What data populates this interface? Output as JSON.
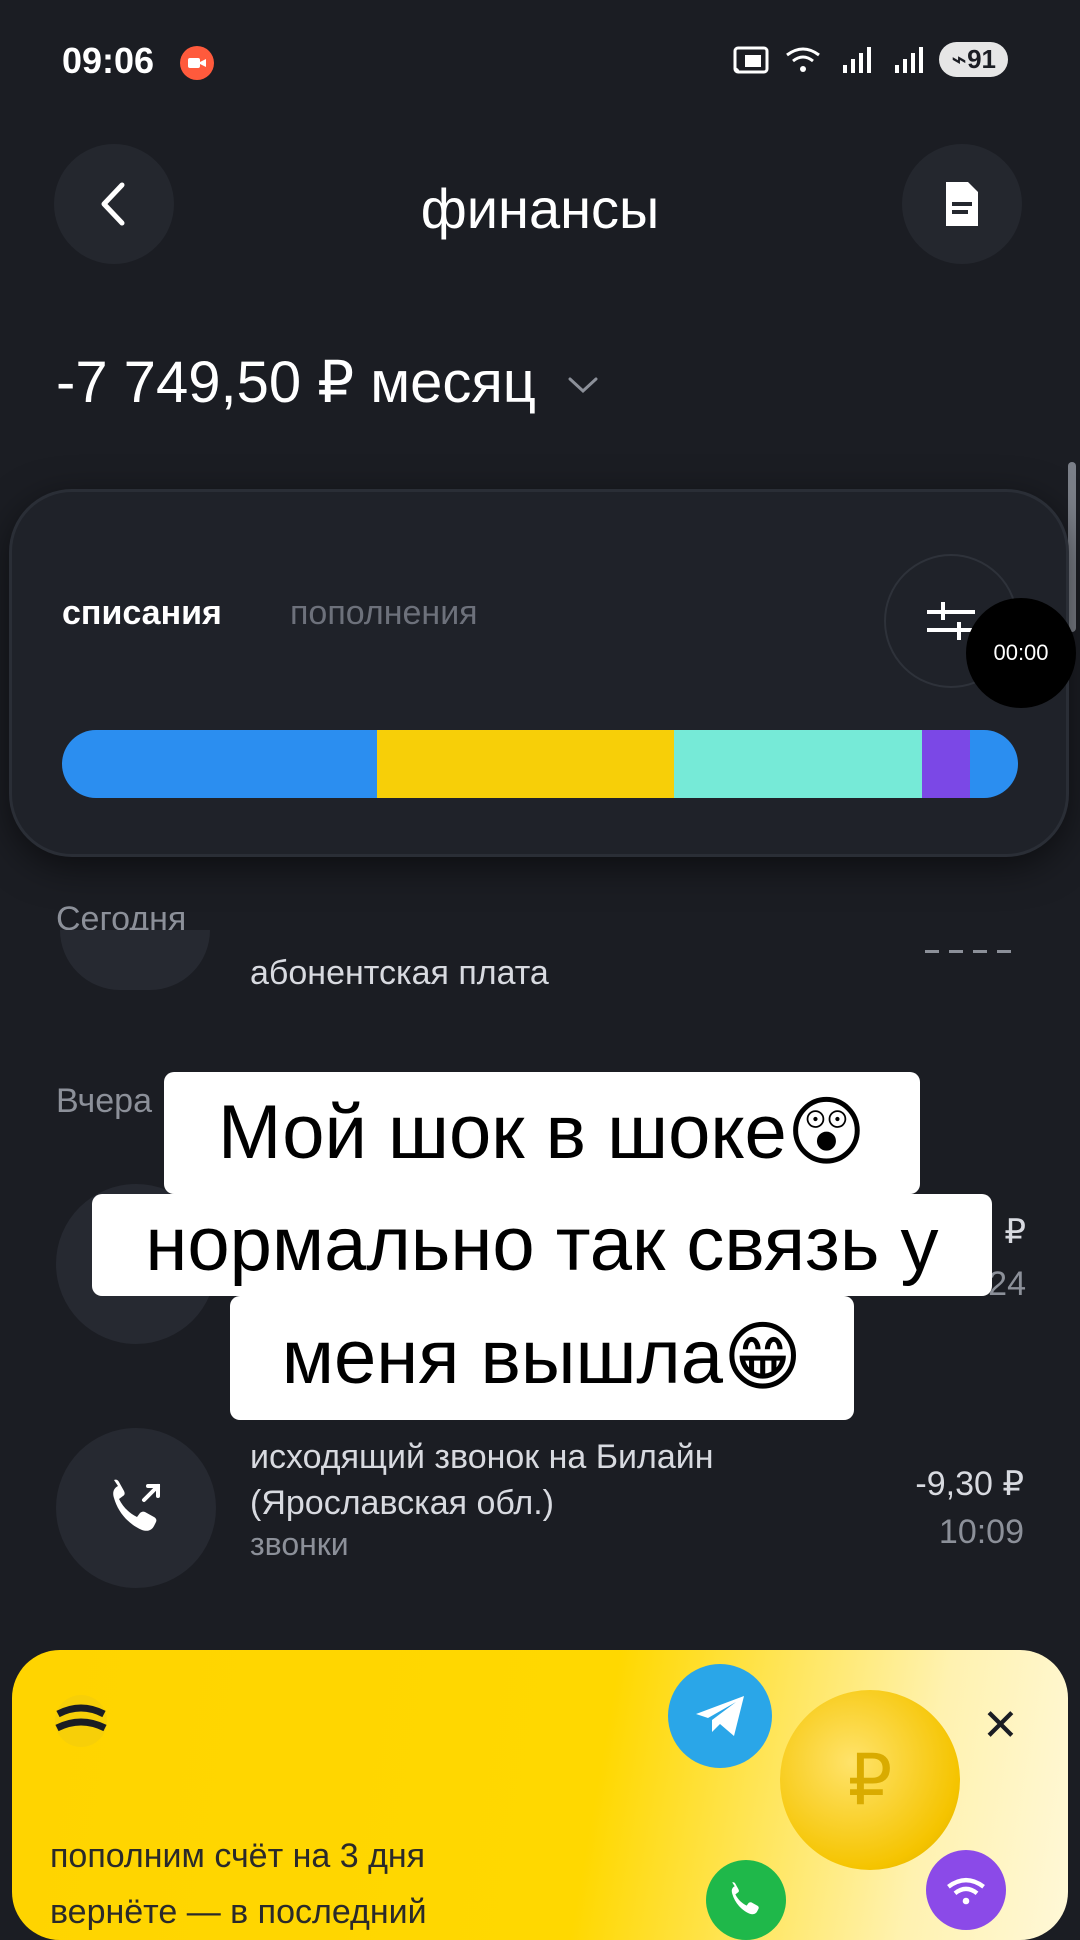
{
  "status_bar": {
    "time": "09:06",
    "battery": "91",
    "icons": [
      "screen-record-icon",
      "cast-icon",
      "wifi-icon",
      "signal-r-icon",
      "signal-r-icon"
    ]
  },
  "header": {
    "title": "финансы",
    "back_icon": "chevron-left-icon",
    "doc_icon": "document-icon"
  },
  "balance": {
    "amount_label": "-7 749,50 ₽ месяц"
  },
  "card": {
    "tabs": [
      {
        "label": "списания",
        "active": true
      },
      {
        "label": "пополнения",
        "active": false
      }
    ],
    "filter_icon": "sliders-icon",
    "timer": "00:00",
    "bar_segments": [
      {
        "color": "#2b8ef0",
        "fraction": 0.33
      },
      {
        "color": "#f7cf08",
        "fraction": 0.31
      },
      {
        "color": "#76ead7",
        "fraction": 0.26
      },
      {
        "color": "#7b48e6",
        "fraction": 0.05
      },
      {
        "color": "#2b8ef0",
        "fraction": 0.05
      }
    ]
  },
  "list": {
    "today_label": "Сегодня",
    "today_item_title": "абонентская плата",
    "yesterday_label": "Вчера",
    "yesterday_item_amount_fragment": "₽",
    "yesterday_item_time_fragment": "24",
    "call_item": {
      "title_line1": "исходящий звонок на Билайн",
      "title_line2": "(Ярославская обл.)",
      "category": "звонки",
      "amount": "-9,30 ₽",
      "time": "10:09"
    }
  },
  "caption": {
    "line1": "Мой шок в шоке😲",
    "line2": "нормально так связь у",
    "line3": "меня вышла😁"
  },
  "promo": {
    "line1": "пополним счёт на 3 дня",
    "line2": "вернёте — в последний",
    "coin_symbol": "₽",
    "close_icon": "close-icon"
  }
}
